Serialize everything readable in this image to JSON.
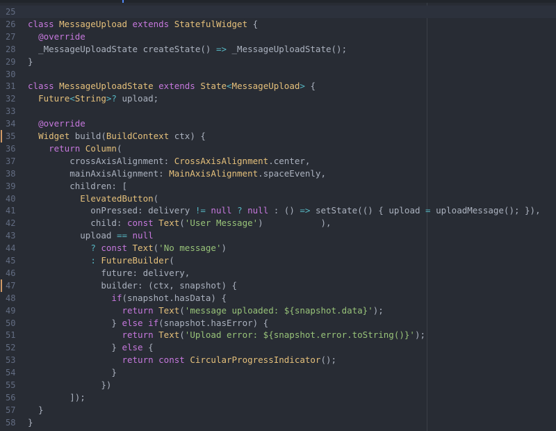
{
  "editor": {
    "language": "Dart",
    "modified_lines": [
      35,
      47
    ],
    "lines": [
      {
        "n": "25",
        "tokens": []
      },
      {
        "n": "26",
        "tokens": [
          [
            "kw",
            "class "
          ],
          [
            "ty",
            "MessageUpload "
          ],
          [
            "kw",
            "extends "
          ],
          [
            "ty",
            "StatefulWidget"
          ],
          [
            "pl",
            " {"
          ]
        ]
      },
      {
        "n": "27",
        "tokens": [
          [
            "pl",
            "  "
          ],
          [
            "an",
            "@override"
          ]
        ]
      },
      {
        "n": "28",
        "tokens": [
          [
            "pl",
            "  _MessageUploadState createState() "
          ],
          [
            "op",
            "=>"
          ],
          [
            "pl",
            " _MessageUploadState();"
          ]
        ]
      },
      {
        "n": "29",
        "tokens": [
          [
            "pl",
            "}"
          ]
        ]
      },
      {
        "n": "30",
        "tokens": []
      },
      {
        "n": "31",
        "tokens": [
          [
            "kw",
            "class "
          ],
          [
            "ty",
            "MessageUploadState "
          ],
          [
            "kw",
            "extends "
          ],
          [
            "ty",
            "State"
          ],
          [
            "op",
            "<"
          ],
          [
            "ty",
            "MessageUpload"
          ],
          [
            "op",
            "> "
          ],
          [
            "pl",
            "{"
          ]
        ]
      },
      {
        "n": "32",
        "tokens": [
          [
            "pl",
            "  "
          ],
          [
            "ty",
            "Future"
          ],
          [
            "op",
            "<"
          ],
          [
            "ty",
            "String"
          ],
          [
            "op",
            ">? "
          ],
          [
            "pl",
            "upload;"
          ]
        ]
      },
      {
        "n": "33",
        "tokens": []
      },
      {
        "n": "34",
        "tokens": [
          [
            "pl",
            "  "
          ],
          [
            "an",
            "@override"
          ]
        ]
      },
      {
        "n": "35",
        "tokens": [
          [
            "pl",
            "  "
          ],
          [
            "ty",
            "Widget "
          ],
          [
            "pl",
            "build("
          ],
          [
            "ty",
            "BuildContext "
          ],
          [
            "pl",
            "ctx) {"
          ]
        ]
      },
      {
        "n": "36",
        "tokens": [
          [
            "pl",
            "    "
          ],
          [
            "kw",
            "return "
          ],
          [
            "ty",
            "Column"
          ],
          [
            "pl",
            "("
          ]
        ]
      },
      {
        "n": "37",
        "tokens": [
          [
            "pl",
            "        crossAxisAlignment: "
          ],
          [
            "ty",
            "CrossAxisAlignment"
          ],
          [
            "pl",
            ".center,"
          ]
        ]
      },
      {
        "n": "38",
        "tokens": [
          [
            "pl",
            "        mainAxisAlignment: "
          ],
          [
            "ty",
            "MainAxisAlignment"
          ],
          [
            "pl",
            ".spaceEvenly,"
          ]
        ]
      },
      {
        "n": "39",
        "tokens": [
          [
            "pl",
            "        children: ["
          ]
        ]
      },
      {
        "n": "40",
        "tokens": [
          [
            "pl",
            "          "
          ],
          [
            "ty",
            "ElevatedButton"
          ],
          [
            "pl",
            "("
          ]
        ]
      },
      {
        "n": "41",
        "tokens": [
          [
            "pl",
            "            onPressed: delivery "
          ],
          [
            "op",
            "!="
          ],
          [
            "pl",
            " "
          ],
          [
            "lit",
            "null"
          ],
          [
            "pl",
            " "
          ],
          [
            "op",
            "?"
          ],
          [
            "pl",
            " "
          ],
          [
            "lit",
            "null"
          ],
          [
            "pl",
            " : () "
          ],
          [
            "op",
            "=>"
          ],
          [
            "pl",
            " setState(() { upload "
          ],
          [
            "op",
            "="
          ],
          [
            "pl",
            " uploadMessage(); }),"
          ]
        ]
      },
      {
        "n": "42",
        "tokens": [
          [
            "pl",
            "            child: "
          ],
          [
            "kw",
            "const "
          ],
          [
            "ty",
            "Text"
          ],
          [
            "pl",
            "("
          ],
          [
            "str",
            "'User Message'"
          ],
          [
            "pl",
            ")           ),"
          ]
        ]
      },
      {
        "n": "43",
        "tokens": [
          [
            "pl",
            "          upload "
          ],
          [
            "op",
            "=="
          ],
          [
            "pl",
            " "
          ],
          [
            "lit",
            "null"
          ]
        ]
      },
      {
        "n": "44",
        "tokens": [
          [
            "pl",
            "            "
          ],
          [
            "op",
            "?"
          ],
          [
            "pl",
            " "
          ],
          [
            "kw",
            "const "
          ],
          [
            "ty",
            "Text"
          ],
          [
            "pl",
            "("
          ],
          [
            "str",
            "'No message'"
          ],
          [
            "pl",
            ")"
          ]
        ]
      },
      {
        "n": "45",
        "tokens": [
          [
            "pl",
            "            "
          ],
          [
            "op",
            ":"
          ],
          [
            "pl",
            " "
          ],
          [
            "ty",
            "FutureBuilder"
          ],
          [
            "pl",
            "("
          ]
        ]
      },
      {
        "n": "46",
        "tokens": [
          [
            "pl",
            "              future: delivery,"
          ]
        ]
      },
      {
        "n": "47",
        "tokens": [
          [
            "pl",
            "              builder: (ctx, snapshot) {"
          ]
        ]
      },
      {
        "n": "48",
        "tokens": [
          [
            "pl",
            "                "
          ],
          [
            "kw",
            "if"
          ],
          [
            "pl",
            "(snapshot.hasData) {"
          ]
        ]
      },
      {
        "n": "49",
        "tokens": [
          [
            "pl",
            "                  "
          ],
          [
            "kw",
            "return "
          ],
          [
            "ty",
            "Text"
          ],
          [
            "pl",
            "("
          ],
          [
            "str",
            "'message uploaded: ${snapshot.data}'"
          ],
          [
            "pl",
            ");"
          ]
        ]
      },
      {
        "n": "50",
        "tokens": [
          [
            "pl",
            "                } "
          ],
          [
            "kw",
            "else if"
          ],
          [
            "pl",
            "(snapshot.hasError) {"
          ]
        ]
      },
      {
        "n": "51",
        "tokens": [
          [
            "pl",
            "                  "
          ],
          [
            "kw",
            "return "
          ],
          [
            "ty",
            "Text"
          ],
          [
            "pl",
            "("
          ],
          [
            "str",
            "'Upload error: ${snapshot.error.toString()}'"
          ],
          [
            "pl",
            ");"
          ]
        ]
      },
      {
        "n": "52",
        "tokens": [
          [
            "pl",
            "                } "
          ],
          [
            "kw",
            "else "
          ],
          [
            "pl",
            "{"
          ]
        ]
      },
      {
        "n": "53",
        "tokens": [
          [
            "pl",
            "                  "
          ],
          [
            "kw",
            "return const "
          ],
          [
            "ty",
            "CircularProgressIndicator"
          ],
          [
            "pl",
            "();"
          ]
        ]
      },
      {
        "n": "54",
        "tokens": [
          [
            "pl",
            "                }"
          ]
        ]
      },
      {
        "n": "55",
        "tokens": [
          [
            "pl",
            "              })"
          ]
        ]
      },
      {
        "n": "56",
        "tokens": [
          [
            "pl",
            "        ]);"
          ]
        ]
      },
      {
        "n": "57",
        "tokens": [
          [
            "pl",
            "  }"
          ]
        ]
      },
      {
        "n": "58",
        "tokens": [
          [
            "pl",
            "}"
          ]
        ]
      }
    ]
  },
  "colors": {
    "background": "#282c34",
    "keyword": "#c678dd",
    "type": "#e5c07b",
    "string": "#98c379",
    "operator": "#56b6c2",
    "plain": "#abb2bf",
    "line_number": "#636d83",
    "modified_marker": "#d19a66"
  }
}
